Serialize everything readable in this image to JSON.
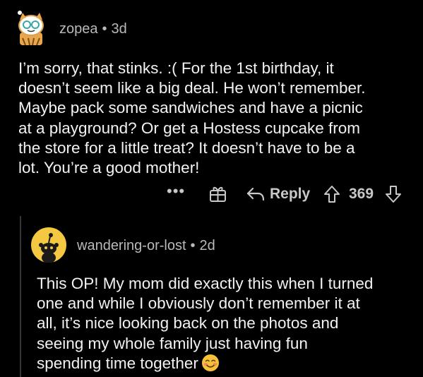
{
  "comment1": {
    "username": "zopea",
    "separator": "•",
    "age": "3d",
    "avatar_icon": "snoo-avatar-icon",
    "lines": [
      "I’m sorry, that stinks. :( For the 1st birthday, it",
      "doesn’t seem like a big deal. He won’t remember.",
      "Maybe pack some sandwiches and have a picnic",
      "at a playground? Or get a Hostess cupcake from",
      "the store for a little treat? It doesn’t have to be a",
      "lot. You’re a good mother!"
    ],
    "actions": {
      "more": "•••",
      "award_icon": "gift-icon",
      "reply_icon": "reply-arrow-icon",
      "reply_label": "Reply",
      "upvote_icon": "upvote-arrow-icon",
      "score": "369",
      "downvote_icon": "downvote-arrow-icon"
    }
  },
  "comment2": {
    "username": "wandering-or-lost",
    "separator": "•",
    "age": "2d",
    "avatar_icon": "default-snoo-avatar-icon",
    "lines": [
      "This OP! My mom did exactly this when I turned",
      "one and while I obviously don’t remember it at",
      "all, it’s nice looking back on the photos and",
      "seeing my whole family just having fun",
      "spending time together"
    ],
    "emoji": "smiling-blushing-face-emoji"
  },
  "colors": {
    "background": "#000000",
    "text": "#f1f2f3",
    "meta": "#b7babc",
    "icon": "#c6c8ca",
    "avatar_yellow": "#f5c842"
  }
}
